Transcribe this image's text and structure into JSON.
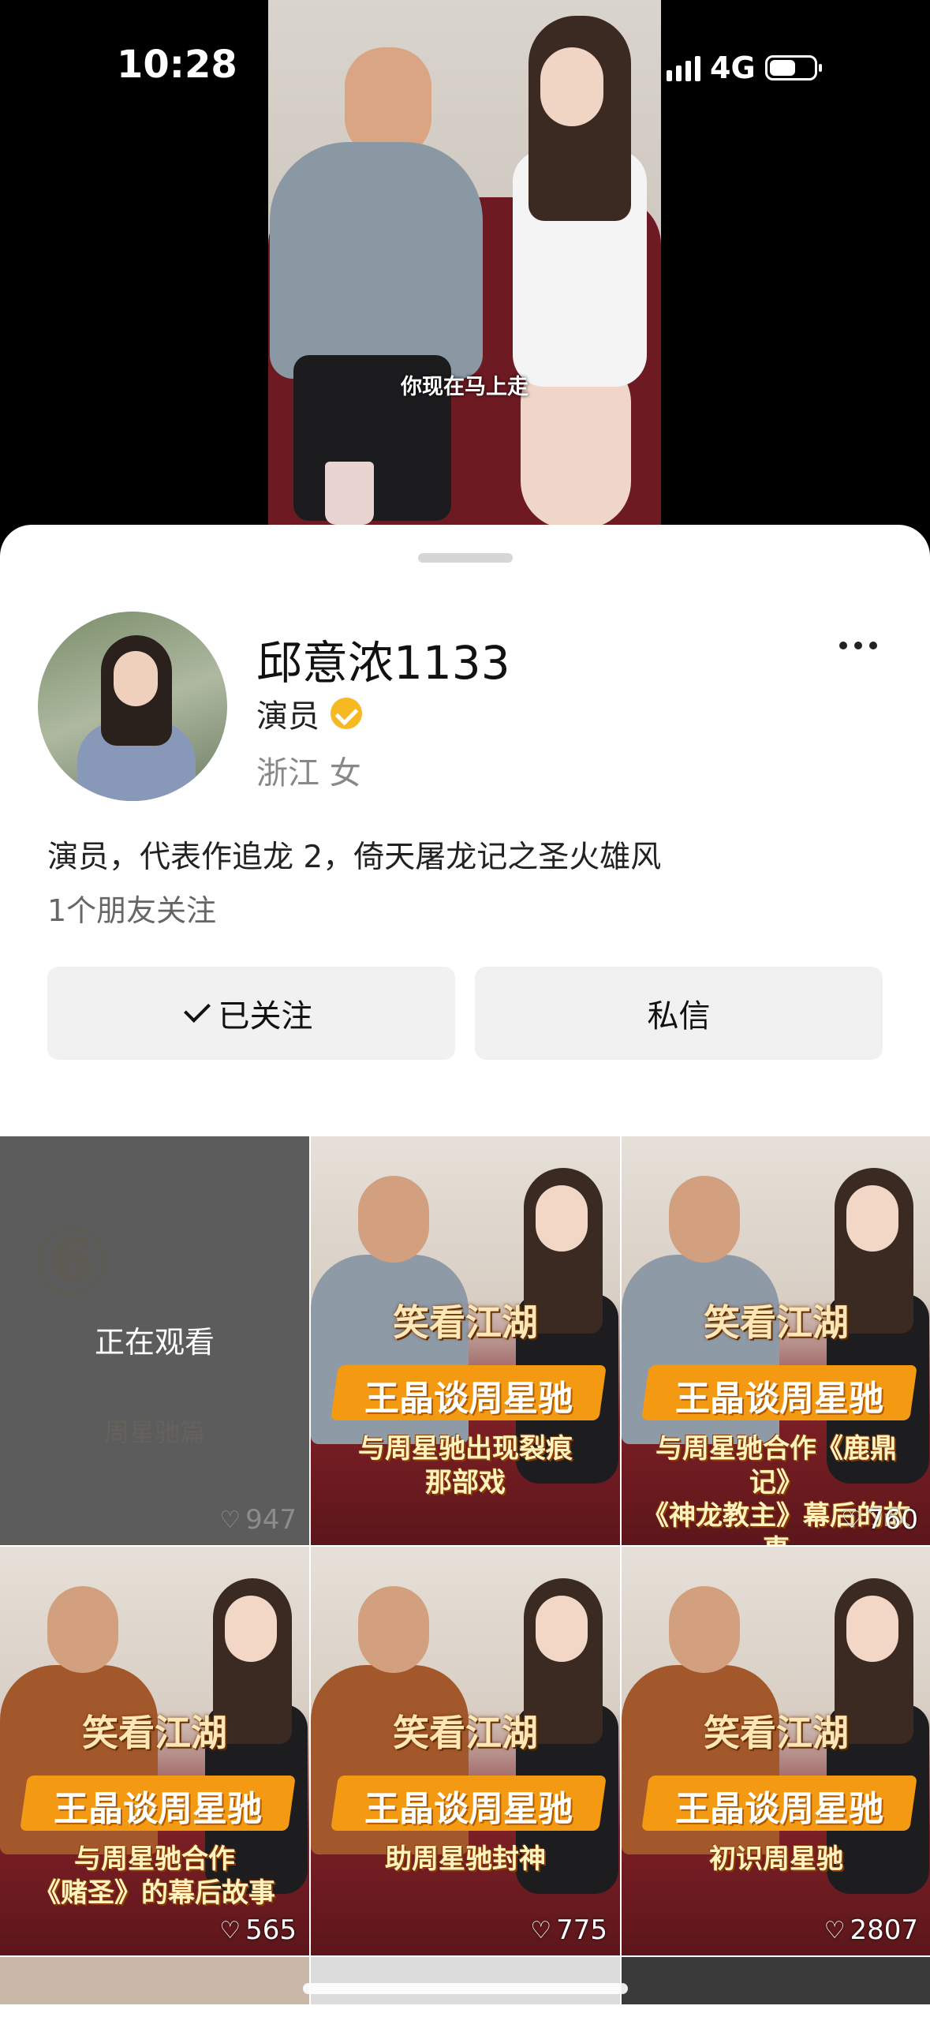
{
  "status_bar": {
    "time": "10:28",
    "network": "4G",
    "battery_level": 0.6
  },
  "video": {
    "subtitle": "你现在马上走"
  },
  "profile": {
    "name": "邱意浓1133",
    "role": "演员",
    "location": "浙江  女",
    "bio": "演员，代表作追龙 2，倚天屠龙记之圣火雄风",
    "friends_following": "1个朋友关注",
    "follow_button": "已关注",
    "message_button": "私信"
  },
  "videos": [
    {
      "watching_label": "正在观看",
      "watermark": "周星驰篇",
      "likes": "947"
    },
    {
      "logo": "笑看江湖",
      "banner": "王晶谈周星驰",
      "subtitle": "与周星驰出现裂痕\n那部戏",
      "likes": "",
      "shirt": "#8e9aa6"
    },
    {
      "logo": "笑看江湖",
      "banner": "王晶谈周星驰",
      "subtitle": "与周星驰合作《鹿鼎记》\n《神龙教主》幕后的故事",
      "likes": "760",
      "shirt": "#8e9aa6"
    },
    {
      "logo": "笑看江湖",
      "banner": "王晶谈周星驰",
      "subtitle": "与周星驰合作\n《赌圣》的幕后故事",
      "likes": "565",
      "shirt": "#a3582c"
    },
    {
      "logo": "笑看江湖",
      "banner": "王晶谈周星驰",
      "subtitle": "助周星驰封神",
      "likes": "775",
      "shirt": "#a3582c"
    },
    {
      "logo": "笑看江湖",
      "banner": "王晶谈周星驰",
      "subtitle": "初识周星驰",
      "likes": "2807",
      "shirt": "#a3582c"
    }
  ]
}
